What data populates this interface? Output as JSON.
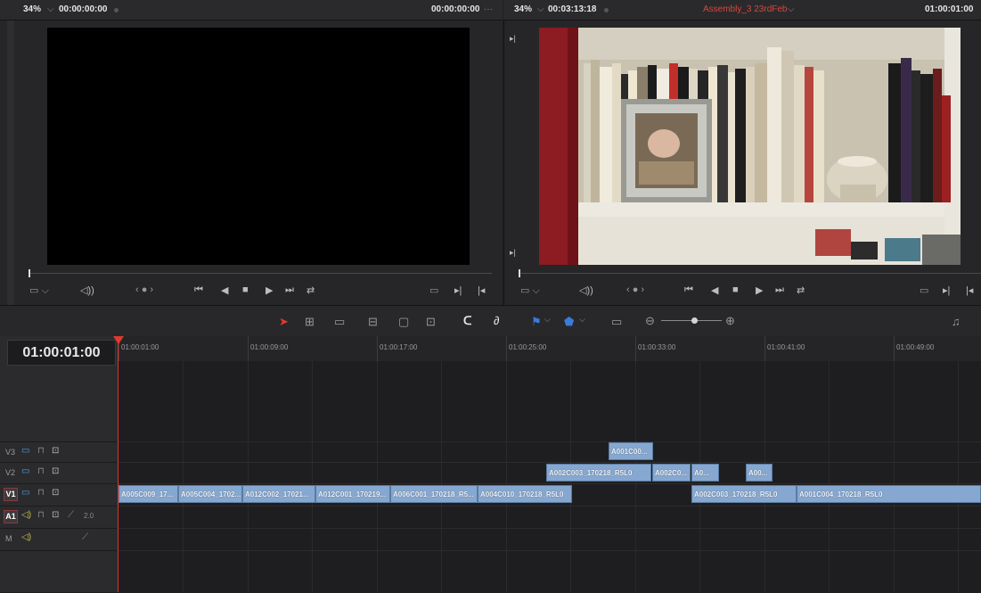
{
  "source_viewer": {
    "zoom": "34%",
    "timecode_left": "00:00:00:00",
    "timecode_right": "00:00:00:00",
    "more": "···"
  },
  "timeline_viewer": {
    "zoom": "34%",
    "timecode_left": "00:03:13:18",
    "timeline_name": "Assembly_3 23rdFeb",
    "timecode_right": "01:00:01:00"
  },
  "timeline": {
    "current_timecode": "01:00:01:00",
    "ruler_labels": [
      "01:00:01:00",
      "01:00:09:00",
      "01:00:17:00",
      "01:00:25:00",
      "01:00:33:00",
      "01:00:41:00",
      "01:00:49:00"
    ],
    "tracks": [
      {
        "id": "V3",
        "label": "V3"
      },
      {
        "id": "V2",
        "label": "V2"
      },
      {
        "id": "V1",
        "label": "V1"
      },
      {
        "id": "A1",
        "label": "A1",
        "level": "2.0"
      },
      {
        "id": "M",
        "label": "M"
      }
    ],
    "clips_v3": [
      "A001C00..."
    ],
    "clips_v2": [
      "A002C003_170218_R5L0",
      "A002C0...",
      "A0...",
      "A00..."
    ],
    "clips_v1": [
      "A005C009_17...",
      "A005C004_1702...",
      "A012C002_17021...",
      "A012C001_170219...",
      "A006C001_170218_R5...",
      "A004C010_170218_R5L0",
      "A002C003_170218_R5L0",
      "A001C004_170218_R5L0"
    ]
  },
  "colors": {
    "clip": "#86a7cf",
    "playhead": "#e0392d",
    "timeline_name": "#d6473b",
    "selected_tool": "#e0392d",
    "flag": "#3b7bd9"
  }
}
